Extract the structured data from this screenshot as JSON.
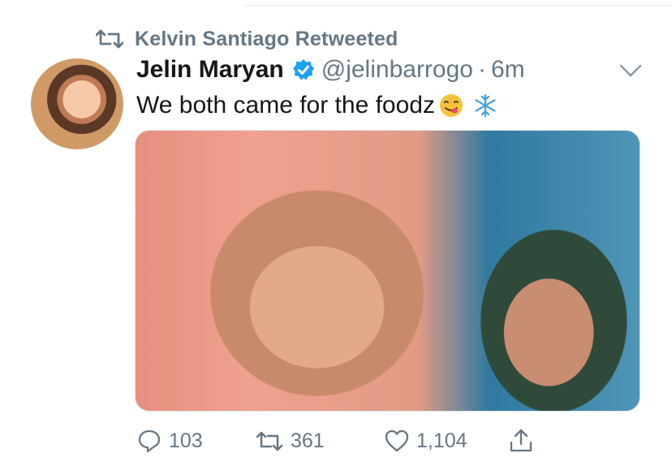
{
  "retweet": {
    "text": "Kelvin Santiago Retweeted"
  },
  "tweet": {
    "author_name": "Jelin Maryan",
    "handle": "@jelinbarrogo",
    "separator": "·",
    "time": "6m",
    "text": "We both came for the foodz"
  },
  "stats": {
    "replies": "103",
    "retweets": "361",
    "likes": "1,104"
  },
  "icons": {
    "retweet": "retweet-icon",
    "verified": "verified-badge-icon",
    "menu": "chevron-down-icon",
    "reply": "reply-icon",
    "like": "like-icon",
    "share": "share-icon",
    "emoji_1": "yum-emoji-icon",
    "emoji_2": "snowflake-emoji-icon"
  },
  "colors": {
    "accent": "#1da1f2",
    "secondary_text": "#657786",
    "primary_text": "#14171a"
  }
}
